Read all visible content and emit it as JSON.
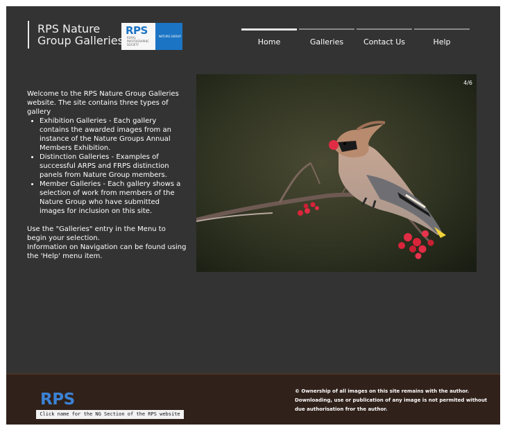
{
  "header": {
    "title_line1": "RPS Nature",
    "title_line2": "Group Galleries",
    "logo_text": "RPS",
    "logo_sub": "ROYAL PHOTOGRAPHIC SOCIETY",
    "logo_right": "NATURE GROUP"
  },
  "nav": {
    "items": [
      {
        "label": "Home"
      },
      {
        "label": "Galleries"
      },
      {
        "label": "Contact Us"
      },
      {
        "label": "Help"
      }
    ]
  },
  "intro": {
    "lead": "Welcome to the RPS Nature Group Galleries website. The site contains three types of gallery",
    "bullets": [
      "Exhibition Galleries - Each gallery contains the awarded images from an instance of the Nature Groups Annual Members Exhibition.",
      "Distinction Galleries - Examples of successful ARPS and FRPS distinction panels from Nature Group members.",
      "Member Galleries - Each gallery shows a selection of work from members of the Nature Group who have submitted images for inclusion on this site."
    ],
    "p2": "Use the \"Galleries\" entry in the Menu to begin your selection.",
    "p3": "Information on Navigation can be found using the 'Help' menu item."
  },
  "gallery": {
    "counter": "4/6"
  },
  "footer": {
    "rps": "RPS",
    "link_text": "Click name for the NG Section of the RPS website",
    "copyright": "© Ownership of all images on this site remains with the author. Downloading, use or publication of any image is not permited without due authorisation fror the author."
  },
  "colors": {
    "page_bg": "#333333",
    "footer_bg": "#30211a",
    "accent_blue": "#1b74c4"
  }
}
